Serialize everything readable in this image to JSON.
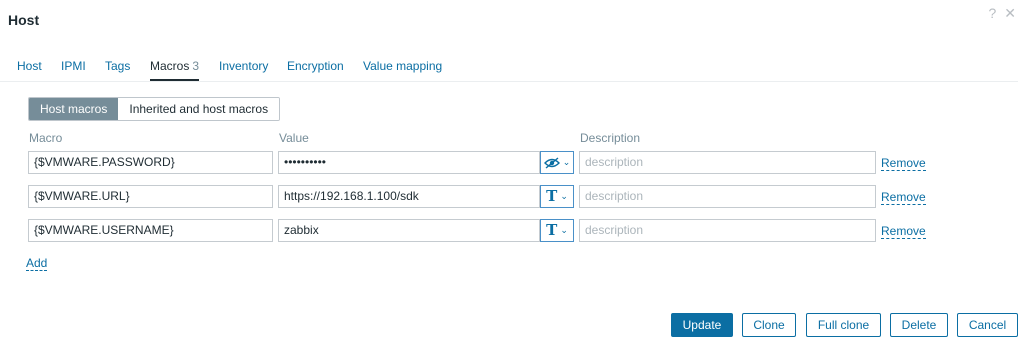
{
  "dialog": {
    "title": "Host",
    "help_icon": "?",
    "close_icon": "✕"
  },
  "tabs": [
    {
      "label": "Host"
    },
    {
      "label": "IPMI"
    },
    {
      "label": "Tags"
    },
    {
      "label": "Macros",
      "count": "3",
      "active": true
    },
    {
      "label": "Inventory"
    },
    {
      "label": "Encryption"
    },
    {
      "label": "Value mapping"
    }
  ],
  "macro_view": {
    "host_macros": "Host macros",
    "inherited_macros": "Inherited and host macros",
    "selected": "Host macros"
  },
  "columns": {
    "macro": "Macro",
    "value": "Value",
    "description": "Description"
  },
  "macros": [
    {
      "macro": "{$VMWARE.PASSWORD}",
      "value": "••••••••••",
      "type_icon": "eye-slash-icon",
      "description_placeholder": "description",
      "remove": "Remove"
    },
    {
      "macro": "{$VMWARE.URL}",
      "value": "https://192.168.1.100/sdk",
      "type_icon": "T",
      "description_placeholder": "description",
      "remove": "Remove"
    },
    {
      "macro": "{$VMWARE.USERNAME}",
      "value": "zabbix",
      "type_icon": "T",
      "description_placeholder": "description",
      "remove": "Remove"
    }
  ],
  "add_label": "Add",
  "buttons": {
    "update": "Update",
    "clone": "Clone",
    "full_clone": "Full clone",
    "delete": "Delete",
    "cancel": "Cancel"
  },
  "colors": {
    "accent": "#0b6ea3",
    "segment_active": "#768d99"
  }
}
